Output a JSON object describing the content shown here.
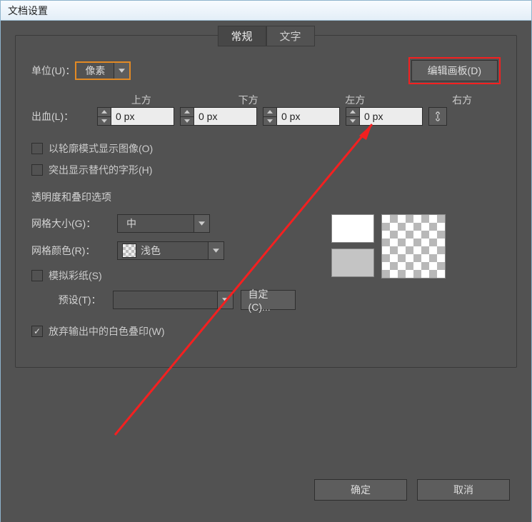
{
  "title": "文档设置",
  "tabs": {
    "general": "常规",
    "text": "文字"
  },
  "unit": {
    "label": "单位(U)：",
    "value": "像素"
  },
  "edit_artboard": "编辑画板(D)",
  "bleed": {
    "label": "出血(L)：",
    "top": "上方",
    "bottom": "下方",
    "left": "左方",
    "right": "右方",
    "val_top": "0 px",
    "val_bottom": "0 px",
    "val_left": "0 px",
    "val_right": "0 px"
  },
  "outline_mode": "以轮廓模式显示图像(O)",
  "highlight_glyphs": "突出显示替代的字形(H)",
  "transparency_title": "透明度和叠印选项",
  "grid_size": {
    "label": "网格大小(G)：",
    "value": "中"
  },
  "grid_color": {
    "label": "网格颜色(R)：",
    "value": "浅色"
  },
  "simulate_paper": "模拟彩纸(S)",
  "preset": {
    "label": "预设(T)：",
    "value": ""
  },
  "custom_btn": "自定(C)...",
  "discard_white": "放弃输出中的白色叠印(W)",
  "ok": "确定",
  "cancel": "取消"
}
